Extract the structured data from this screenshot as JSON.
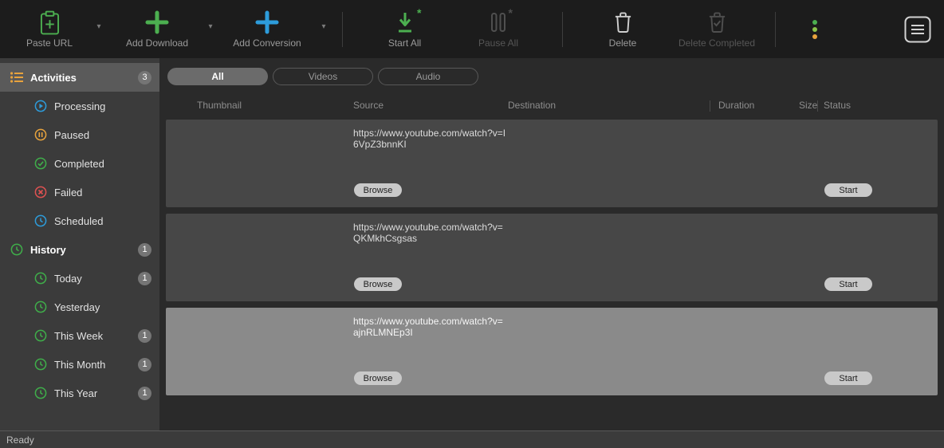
{
  "toolbar": {
    "paste_url_label": "Paste URL",
    "add_download_label": "Add Download",
    "add_conversion_label": "Add Conversion",
    "start_all_label": "Start All",
    "pause_all_label": "Pause All",
    "delete_label": "Delete",
    "delete_completed_label": "Delete Completed"
  },
  "sidebar": {
    "activities": {
      "label": "Activities",
      "badge": "3"
    },
    "activity_children": [
      {
        "label": "Processing"
      },
      {
        "label": "Paused"
      },
      {
        "label": "Completed"
      },
      {
        "label": "Failed"
      },
      {
        "label": "Scheduled"
      }
    ],
    "history": {
      "label": "History",
      "badge": "1"
    },
    "history_children": [
      {
        "label": "Today",
        "badge": "1"
      },
      {
        "label": "Yesterday"
      },
      {
        "label": "This Week",
        "badge": "1"
      },
      {
        "label": "This Month",
        "badge": "1"
      },
      {
        "label": "This Year",
        "badge": "1"
      }
    ]
  },
  "filters": {
    "all": "All",
    "videos": "Videos",
    "audio": "Audio"
  },
  "table": {
    "headers": [
      "Thumbnail",
      "Source",
      "Destination",
      "Duration",
      "Size",
      "Status"
    ]
  },
  "rows": [
    {
      "source_line1": "https://www.youtube.com/watch?v=I",
      "source_line2": "6VpZ3bnnKI",
      "browse": "Browse",
      "start": "Start"
    },
    {
      "source_line1": "https://www.youtube.com/watch?v=",
      "source_line2": "QKMkhCsgsas",
      "browse": "Browse",
      "start": "Start"
    },
    {
      "source_line1": "https://www.youtube.com/watch?v=",
      "source_line2": "ajnRLMNEp3I",
      "browse": "Browse",
      "start": "Start"
    }
  ],
  "statusbar": {
    "text": "Ready"
  },
  "colors": {
    "accent_green": "#4caf50",
    "accent_blue": "#2d9cdb",
    "accent_orange": "#e8a33d",
    "accent_red": "#e05252"
  }
}
